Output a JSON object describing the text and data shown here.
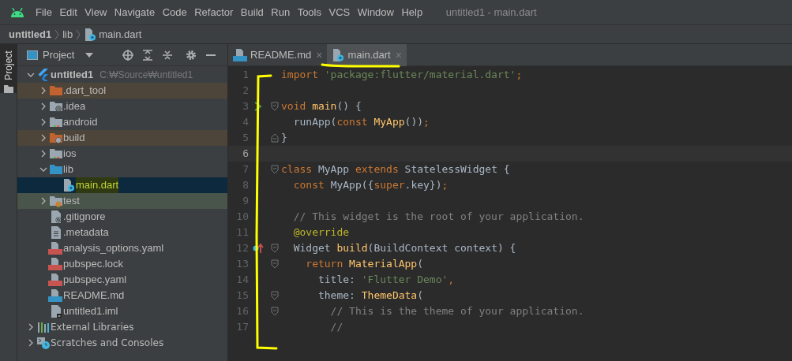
{
  "menu": [
    "File",
    "Edit",
    "View",
    "Navigate",
    "Code",
    "Refactor",
    "Build",
    "Run",
    "Tools",
    "VCS",
    "Window",
    "Help"
  ],
  "window": {
    "title": "untitled1 - main.dart"
  },
  "breadcrumb": [
    {
      "label": "untitled1",
      "kind": "project"
    },
    {
      "label": "lib",
      "kind": "folder"
    },
    {
      "label": "main.dart",
      "kind": "dart-file"
    }
  ],
  "side_tabs": [
    {
      "label": "Project",
      "selected": true
    }
  ],
  "project_panel": {
    "view": "Project"
  },
  "tree": [
    {
      "label": "untitled1",
      "path": "C:₩Source₩untitled1",
      "kind": "flutter",
      "expanded": true,
      "selected": false,
      "children": [
        {
          "label": ".dart_tool",
          "kind": "excluded-folder",
          "expanded": false,
          "selected": false
        },
        {
          "label": ".idea",
          "kind": "config-folder",
          "expanded": false,
          "selected": false
        },
        {
          "label": "android",
          "kind": "module-folder",
          "expanded": false,
          "selected": false
        },
        {
          "label": "build",
          "kind": "excluded-config-folder",
          "expanded": false,
          "selected": false
        },
        {
          "label": "ios",
          "kind": "module-folder",
          "expanded": false,
          "selected": false
        },
        {
          "label": "lib",
          "kind": "source-folder",
          "expanded": true,
          "selected": false,
          "children": [
            {
              "label": "main.dart",
              "kind": "dart-file",
              "selected": true
            }
          ]
        },
        {
          "label": "test",
          "kind": "test-folder",
          "expanded": false,
          "selected": false
        },
        {
          "label": ".gitignore",
          "kind": "ignore-file",
          "selected": false
        },
        {
          "label": ".metadata",
          "kind": "text-file",
          "selected": false
        },
        {
          "label": "analysis_options.yaml",
          "kind": "yaml-file",
          "selected": false
        },
        {
          "label": "pubspec.lock",
          "kind": "yaml-file",
          "selected": false
        },
        {
          "label": "pubspec.yaml",
          "kind": "yaml-file",
          "selected": false
        },
        {
          "label": "README.md",
          "kind": "md-file",
          "selected": false
        },
        {
          "label": "untitled1.iml",
          "kind": "iml-file",
          "selected": false
        }
      ]
    },
    {
      "label": "External Libraries",
      "kind": "libraries",
      "expanded": false,
      "selected": false
    },
    {
      "label": "Scratches and Consoles",
      "kind": "scratches",
      "expanded": false,
      "selected": false
    }
  ],
  "editor_tabs": [
    {
      "label": "README.md",
      "kind": "md-file",
      "close": "×",
      "selected": false
    },
    {
      "label": "main.dart",
      "kind": "dart-file",
      "close": "×",
      "selected": true
    }
  ],
  "code": [
    {
      "number": "1",
      "current": false,
      "tokens": [
        {
          "t": "import ",
          "kind": "keyword"
        },
        {
          "t": "'package:flutter/material.dart'",
          "kind": "string"
        },
        {
          "t": ";",
          "kind": "keyword"
        }
      ]
    },
    {
      "number": "2",
      "current": false
    },
    {
      "number": "3",
      "current": false,
      "gutter": {
        "kind": "run"
      },
      "fold": {
        "kind": "start"
      },
      "tokens": [
        {
          "t": "void ",
          "kind": "keyword"
        },
        {
          "t": "main",
          "kind": "func"
        },
        {
          "t": "() {",
          "kind": "plain"
        }
      ]
    },
    {
      "number": "4",
      "current": false,
      "tokens": [
        {
          "t": "  runApp(",
          "kind": "plain"
        },
        {
          "t": "const ",
          "kind": "keyword"
        },
        {
          "t": "MyApp",
          "kind": "func"
        },
        {
          "t": "())",
          "kind": "plain"
        },
        {
          "t": ";",
          "kind": "keyword"
        }
      ]
    },
    {
      "number": "5",
      "current": false,
      "fold": {
        "kind": "end"
      },
      "tokens": [
        {
          "t": "}",
          "kind": "plain"
        }
      ]
    },
    {
      "number": "6",
      "current": true
    },
    {
      "number": "7",
      "current": false,
      "fold": {
        "kind": "start"
      },
      "tokens": [
        {
          "t": "class ",
          "kind": "keyword"
        },
        {
          "t": "MyApp ",
          "kind": "type"
        },
        {
          "t": "extends ",
          "kind": "keyword"
        },
        {
          "t": "StatelessWidget {",
          "kind": "type"
        }
      ]
    },
    {
      "number": "8",
      "current": false,
      "tokens": [
        {
          "t": "  const ",
          "kind": "keyword"
        },
        {
          "t": "MyApp",
          "kind": "type"
        },
        {
          "t": "({",
          "kind": "plain"
        },
        {
          "t": "super",
          "kind": "keyword"
        },
        {
          "t": ".key})",
          "kind": "plain"
        },
        {
          "t": ";",
          "kind": "keyword"
        }
      ]
    },
    {
      "number": "9",
      "current": false
    },
    {
      "number": "10",
      "current": false,
      "tokens": [
        {
          "t": "  // This widget is the root of your application.",
          "kind": "comment"
        }
      ]
    },
    {
      "number": "11",
      "current": false,
      "tokens": [
        {
          "t": "  @override",
          "kind": "annotation"
        }
      ]
    },
    {
      "number": "12",
      "current": false,
      "gutter": {
        "kind": "override"
      },
      "fold": {
        "kind": "start"
      },
      "tokens": [
        {
          "t": "  Widget ",
          "kind": "type"
        },
        {
          "t": "build",
          "kind": "func"
        },
        {
          "t": "(BuildContext context) {",
          "kind": "type"
        }
      ]
    },
    {
      "number": "13",
      "current": false,
      "fold": {
        "kind": "start"
      },
      "tokens": [
        {
          "t": "    return ",
          "kind": "keyword"
        },
        {
          "t": "MaterialApp",
          "kind": "func"
        },
        {
          "t": "(",
          "kind": "plain"
        }
      ]
    },
    {
      "number": "14",
      "current": false,
      "tokens": [
        {
          "t": "      title: ",
          "kind": "type"
        },
        {
          "t": "'Flutter Demo'",
          "kind": "string"
        },
        {
          "t": ",",
          "kind": "keyword"
        }
      ]
    },
    {
      "number": "15",
      "current": false,
      "fold": {
        "kind": "start"
      },
      "tokens": [
        {
          "t": "      theme: ",
          "kind": "type"
        },
        {
          "t": "ThemeData",
          "kind": "func"
        },
        {
          "t": "(",
          "kind": "plain"
        }
      ]
    },
    {
      "number": "16",
      "current": false,
      "fold": {
        "kind": "start"
      },
      "tokens": [
        {
          "t": "        // This is the theme of your application.",
          "kind": "comment"
        }
      ]
    },
    {
      "number": "17",
      "current": false,
      "tokens": [
        {
          "t": "        //",
          "kind": "comment"
        }
      ]
    }
  ]
}
